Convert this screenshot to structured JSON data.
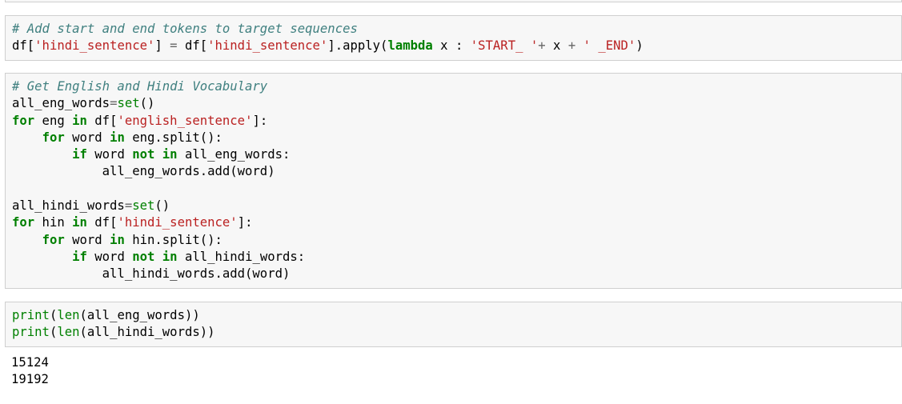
{
  "cell1": {
    "lines": [
      [
        {
          "t": "# Add start and end tokens to target sequences",
          "c": "cm"
        }
      ],
      [
        {
          "t": "df[",
          "c": ""
        },
        {
          "t": "'hindi_sentence'",
          "c": "st"
        },
        {
          "t": "] ",
          "c": ""
        },
        {
          "t": "=",
          "c": "op"
        },
        {
          "t": " df[",
          "c": ""
        },
        {
          "t": "'hindi_sentence'",
          "c": "st"
        },
        {
          "t": "].apply(",
          "c": ""
        },
        {
          "t": "lambda",
          "c": "kw"
        },
        {
          "t": " x : ",
          "c": ""
        },
        {
          "t": "'START_ '",
          "c": "st"
        },
        {
          "t": "+",
          "c": "op"
        },
        {
          "t": " x ",
          "c": ""
        },
        {
          "t": "+",
          "c": "op"
        },
        {
          "t": " ",
          "c": ""
        },
        {
          "t": "' _END'",
          "c": "st"
        },
        {
          "t": ")",
          "c": ""
        }
      ]
    ]
  },
  "cell2": {
    "lines": [
      [
        {
          "t": "# Get English and Hindi Vocabulary",
          "c": "cm"
        }
      ],
      [
        {
          "t": "all_eng_words",
          "c": ""
        },
        {
          "t": "=",
          "c": "op"
        },
        {
          "t": "set",
          "c": "bi"
        },
        {
          "t": "()",
          "c": ""
        }
      ],
      [
        {
          "t": "for",
          "c": "kw"
        },
        {
          "t": " eng ",
          "c": ""
        },
        {
          "t": "in",
          "c": "kw"
        },
        {
          "t": " df[",
          "c": ""
        },
        {
          "t": "'english_sentence'",
          "c": "st"
        },
        {
          "t": "]:",
          "c": ""
        }
      ],
      [
        {
          "t": "    ",
          "c": ""
        },
        {
          "t": "for",
          "c": "kw"
        },
        {
          "t": " word ",
          "c": ""
        },
        {
          "t": "in",
          "c": "kw"
        },
        {
          "t": " eng.split():",
          "c": ""
        }
      ],
      [
        {
          "t": "        ",
          "c": ""
        },
        {
          "t": "if",
          "c": "kw"
        },
        {
          "t": " word ",
          "c": ""
        },
        {
          "t": "not",
          "c": "kw"
        },
        {
          "t": " ",
          "c": ""
        },
        {
          "t": "in",
          "c": "kw"
        },
        {
          "t": " all_eng_words:",
          "c": ""
        }
      ],
      [
        {
          "t": "            all_eng_words.add(word)",
          "c": ""
        }
      ],
      [
        {
          "t": "",
          "c": ""
        }
      ],
      [
        {
          "t": "all_hindi_words",
          "c": ""
        },
        {
          "t": "=",
          "c": "op"
        },
        {
          "t": "set",
          "c": "bi"
        },
        {
          "t": "()",
          "c": ""
        }
      ],
      [
        {
          "t": "for",
          "c": "kw"
        },
        {
          "t": " hin ",
          "c": ""
        },
        {
          "t": "in",
          "c": "kw"
        },
        {
          "t": " df[",
          "c": ""
        },
        {
          "t": "'hindi_sentence'",
          "c": "st"
        },
        {
          "t": "]:",
          "c": ""
        }
      ],
      [
        {
          "t": "    ",
          "c": ""
        },
        {
          "t": "for",
          "c": "kw"
        },
        {
          "t": " word ",
          "c": ""
        },
        {
          "t": "in",
          "c": "kw"
        },
        {
          "t": " hin.split():",
          "c": ""
        }
      ],
      [
        {
          "t": "        ",
          "c": ""
        },
        {
          "t": "if",
          "c": "kw"
        },
        {
          "t": " word ",
          "c": ""
        },
        {
          "t": "not",
          "c": "kw"
        },
        {
          "t": " ",
          "c": ""
        },
        {
          "t": "in",
          "c": "kw"
        },
        {
          "t": " all_hindi_words:",
          "c": ""
        }
      ],
      [
        {
          "t": "            all_hindi_words.add(word)",
          "c": ""
        }
      ]
    ]
  },
  "cell3": {
    "lines": [
      [
        {
          "t": "print",
          "c": "bi"
        },
        {
          "t": "(",
          "c": ""
        },
        {
          "t": "len",
          "c": "bi"
        },
        {
          "t": "(all_eng_words))",
          "c": ""
        }
      ],
      [
        {
          "t": "print",
          "c": "bi"
        },
        {
          "t": "(",
          "c": ""
        },
        {
          "t": "len",
          "c": "bi"
        },
        {
          "t": "(all_hindi_words))",
          "c": ""
        }
      ]
    ]
  },
  "output": {
    "lines": [
      "15124",
      "19192"
    ]
  },
  "colors": {
    "comment": "#408080",
    "keyword": "#008000",
    "string": "#ba2121",
    "cell_bg": "#f7f7f7",
    "cell_border": "#cfcfcf"
  }
}
